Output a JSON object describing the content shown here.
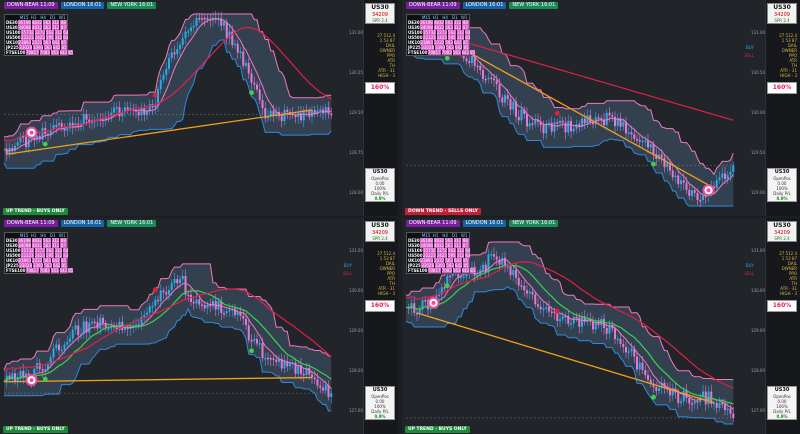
{
  "sessions": {
    "tokyo": "DOWN-BEAR 11:09",
    "london": "LONDON 16:01",
    "ny": "NEW YORK 16:01"
  },
  "table": {
    "headers": [
      "M15",
      "H1",
      "H4",
      "D1",
      "W1"
    ],
    "rows": [
      {
        "sym": "DE30",
        "vals": [
          "36198",
          "4832",
          "563",
          "312",
          "88"
        ]
      },
      {
        "sym": "US30",
        "vals": [
          "34098",
          "4032",
          "563",
          "312",
          "87"
        ]
      },
      {
        "sym": "US100",
        "vals": [
          "15732",
          "2272",
          "563",
          "312",
          "64"
        ]
      },
      {
        "sym": "US500",
        "vals": [
          "22223",
          "2423",
          "595",
          "312",
          "83"
        ]
      },
      {
        "sym": "UK10",
        "vals": [
          "23893",
          "2222",
          "563",
          "642",
          "85"
        ]
      },
      {
        "sym": "JP225",
        "vals": [
          "33028",
          "3393",
          "563",
          "642",
          "85"
        ]
      },
      {
        "sym": "FTSE100",
        "vals": [
          "70817",
          "7083",
          "563",
          "642",
          "85"
        ]
      }
    ]
  },
  "symbol": {
    "name": "US30",
    "price": "34209",
    "spread": "SPR 2.4"
  },
  "stats": [
    "27 512.4",
    "1 53 87",
    "DAIL",
    "OWNER",
    "PPO",
    "ATR",
    "TH",
    "ATR - 31",
    "HIGH - 3"
  ],
  "percent": "160%",
  "mini": {
    "name": "US30",
    "line1": "OpenPos",
    "line2": "0.00",
    "line3": "100%",
    "line4": "Daily P/L",
    "gain": "0.9%"
  },
  "panels": [
    {
      "trend": "UP TREND - BUYS ONLY",
      "trend_kind": "up",
      "axis": [
        "131.00",
        "130.25",
        "129.50",
        "128.75",
        "128.00"
      ]
    },
    {
      "trend": "DOWN TREND - SELLS ONLY",
      "trend_kind": "down",
      "axis": [
        "131.00",
        "130.50",
        "130.00",
        "129.50",
        "129.00"
      ]
    },
    {
      "trend": "UP TREND - BUYS ONLY",
      "trend_kind": "up",
      "axis": [
        "131.00",
        "130.00",
        "129.00",
        "128.00",
        "127.00"
      ]
    },
    {
      "trend": "UP TREND - BUYS ONLY",
      "trend_kind": "up",
      "axis": [
        "131.00",
        "130.00",
        "129.00",
        "128.00",
        "127.00"
      ]
    }
  ],
  "signals": {
    "buy": "BUY",
    "sell": "SELL"
  },
  "colors": {
    "bg": "#212428",
    "band": "#3a4a5c",
    "bull": "#2fa8e8",
    "bear": "#e07ad8",
    "ma_pink": "#f07ac0",
    "ma_red": "#e0204a",
    "ma_green": "#3ed04a",
    "trend_line": "#f0a020",
    "band_line": "#f07ac0",
    "lower_line": "#2f8ae0"
  }
}
